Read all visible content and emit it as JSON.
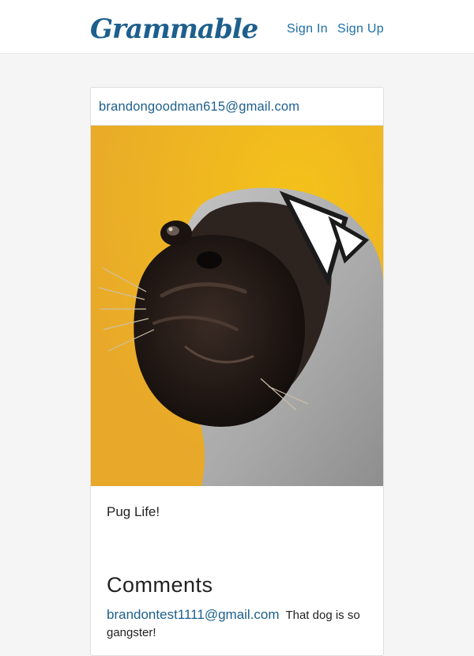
{
  "header": {
    "brand": "Grammable",
    "nav": {
      "sign_in": "Sign In",
      "sign_up": "Sign Up"
    }
  },
  "post": {
    "author_email": "brandongoodman615@gmail.com",
    "photo_icon": "pug-in-hoodie-photo",
    "caption": "Pug Life!",
    "comments_heading": "Comments",
    "comments": [
      {
        "author_email": "brandontest1111@gmail.com",
        "text": "That dog is so gangster!"
      }
    ]
  },
  "colors": {
    "brand": "#1d5f8d",
    "link": "#1d6fa5",
    "page_background": "#f5f5f5",
    "photo_background": "#f1b815"
  }
}
